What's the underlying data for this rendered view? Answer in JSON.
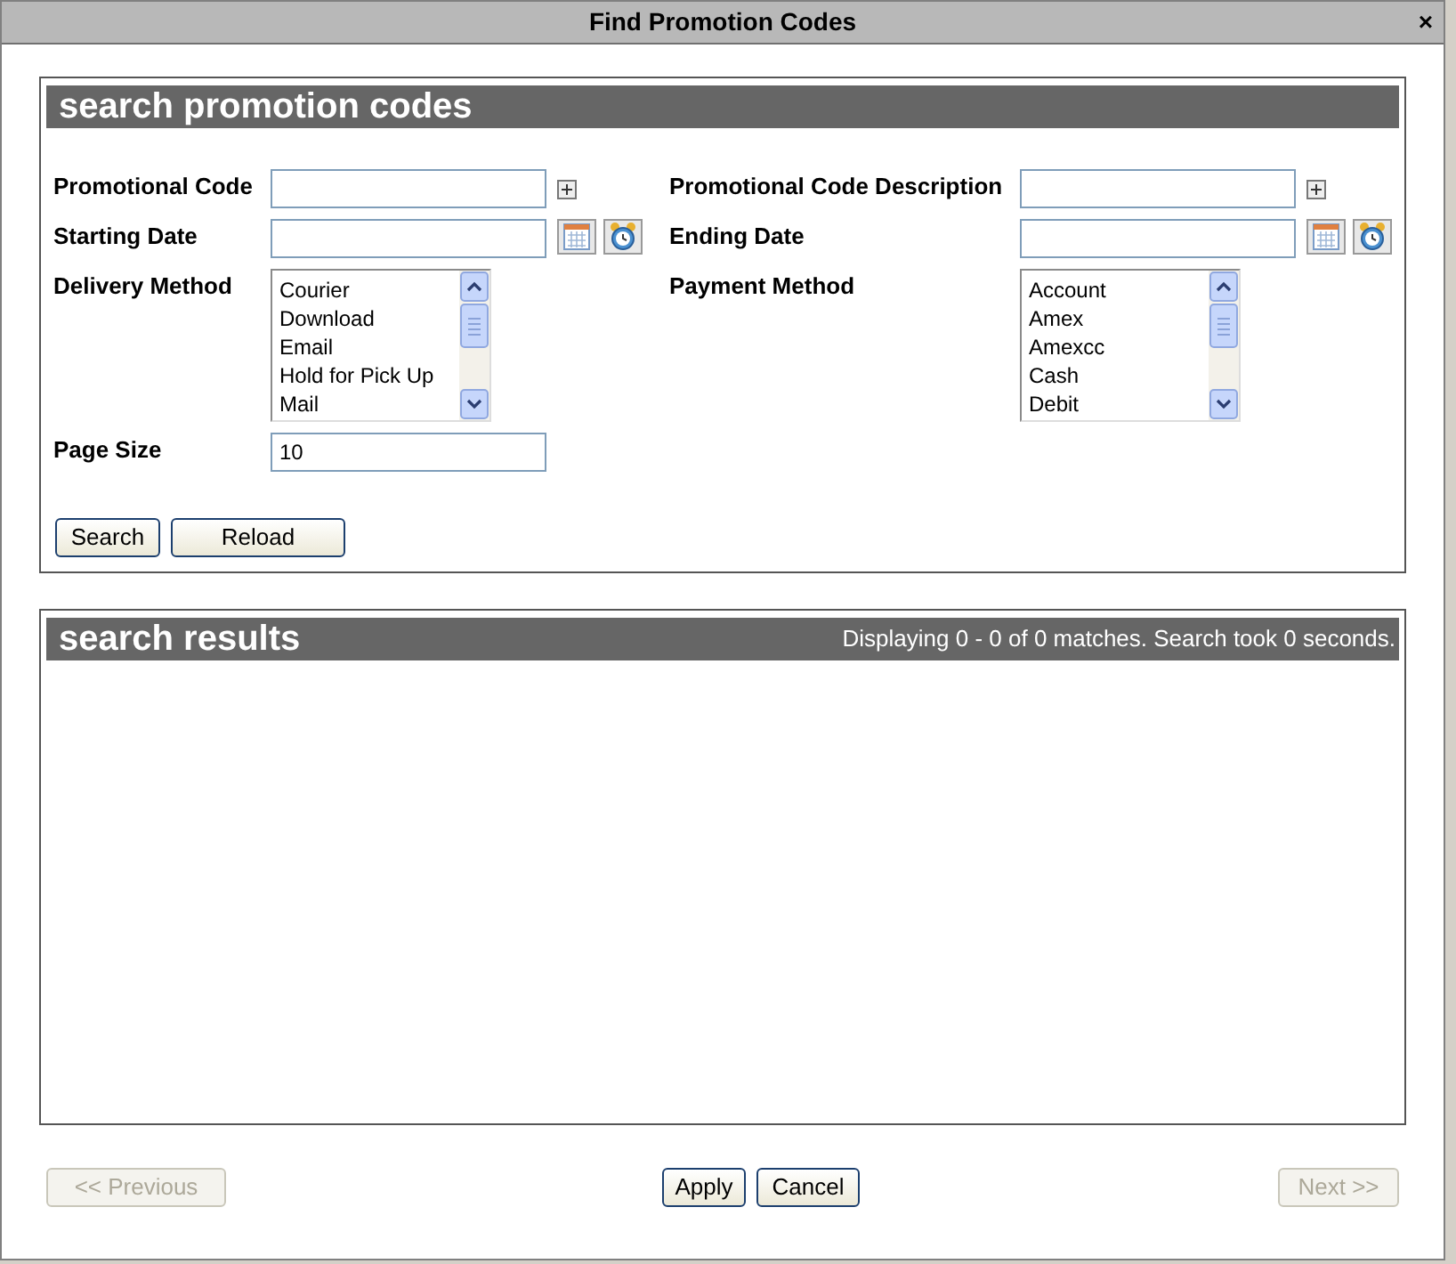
{
  "window": {
    "title": "Find Promotion Codes",
    "close": "×"
  },
  "search_panel": {
    "title": "search promotion codes",
    "left_fields": [
      {
        "kind": "text",
        "label": "Promotional Code"
      },
      {
        "kind": "date",
        "label": "Starting Date"
      },
      {
        "kind": "list",
        "label": "Delivery Method",
        "options": [
          "Courier",
          "Download",
          "Email",
          "Hold for Pick Up",
          "Mail"
        ]
      },
      {
        "kind": "plain",
        "label": "Page Size",
        "value": "10"
      }
    ],
    "right_fields": [
      {
        "kind": "text",
        "label": "Promotional Code Description"
      },
      {
        "kind": "date",
        "label": "Ending Date"
      },
      {
        "kind": "list",
        "label": "Payment Method",
        "options": [
          "Account",
          "Amex",
          "Amexcc",
          "Cash",
          "Debit"
        ]
      }
    ],
    "buttons": [
      {
        "label": "Search"
      },
      {
        "label": "Reload"
      }
    ]
  },
  "results_panel": {
    "title": "search results",
    "status": "Displaying 0 - 0 of 0 matches. Search took 0 seconds."
  },
  "footer": {
    "buttons": [
      {
        "label": "<< Previous",
        "disabled": true
      },
      {
        "label": "Apply",
        "disabled": false
      },
      {
        "label": "Cancel",
        "disabled": false
      },
      {
        "label": "Next >>",
        "disabled": true
      }
    ]
  }
}
